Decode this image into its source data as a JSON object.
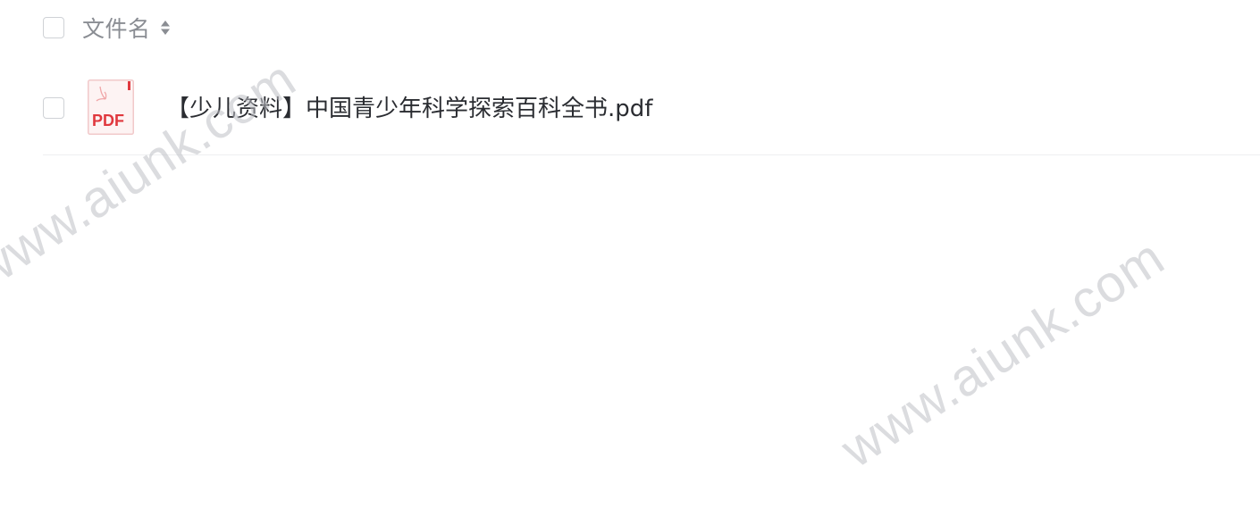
{
  "header": {
    "column_title": "文件名"
  },
  "files": [
    {
      "name": "【少儿资料】中国青少年科学探索百科全书.pdf",
      "type_label": "PDF"
    }
  ],
  "watermark": {
    "text": "www.aiunk.com"
  },
  "colors": {
    "pdf_red": "#e0383e",
    "text_primary": "#2a2c31",
    "text_secondary": "#8a8d93",
    "border": "#cfd2d6"
  }
}
